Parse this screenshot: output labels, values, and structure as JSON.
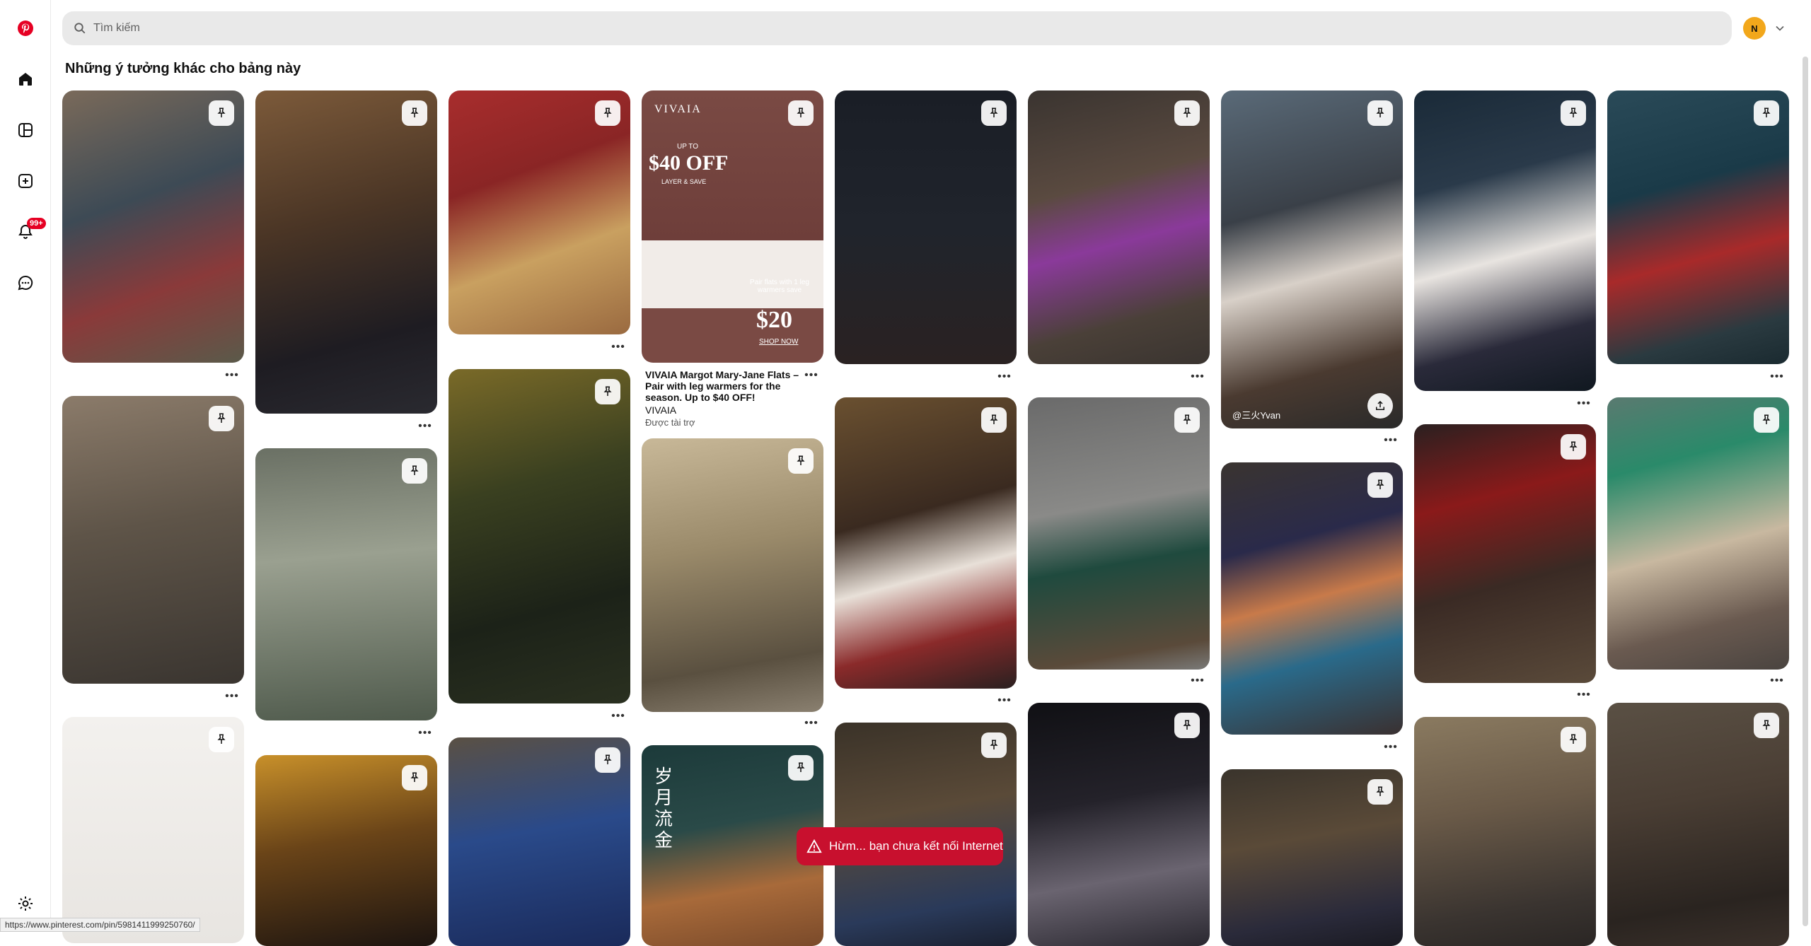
{
  "search": {
    "placeholder": "Tìm kiếm"
  },
  "account": {
    "initial": "N"
  },
  "sidebar": {
    "notifications_badge": "99+"
  },
  "section_title": "Những ý tưởng khác cho bảng này",
  "ad": {
    "logo": "VIVAIA",
    "upto": "UP TO",
    "discount": "$40 OFF",
    "subtitle": "LAYER & SAVE",
    "promo_line": "Pair flats with 1 leg warmers save",
    "price": "$20",
    "cta": "SHOP NOW",
    "title": "VIVAIA Margot Mary-Jane Flats – Pair with leg warmers for the season. Up to $40 OFF!",
    "brand": "VIVAIA",
    "sponsored": "Được tài trợ"
  },
  "pin_caption": "@三火Yvan",
  "poster_text": "岁月流金",
  "toast": {
    "message": "Hừm... bạn chưa kết nối Internet"
  },
  "status_url": "https://www.pinterest.com/pin/5981411999250760/",
  "colors": {
    "brand": "#e60023",
    "toast": "#c8102e",
    "avatar": "#f2a71b"
  }
}
